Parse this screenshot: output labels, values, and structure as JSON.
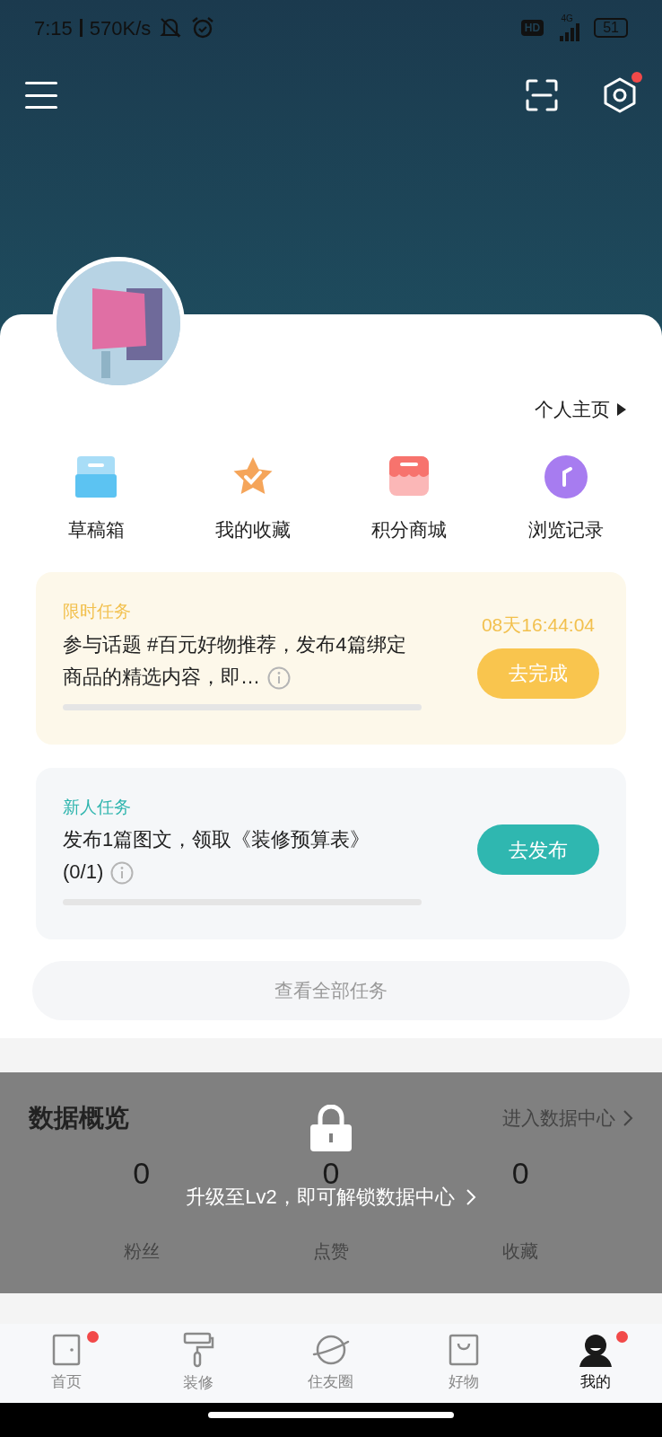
{
  "status_bar": {
    "time": "7:15",
    "speed": "570K/s",
    "hd": "HD",
    "network": "4G",
    "battery": "51"
  },
  "profile": {
    "homepage_link": "个人主页"
  },
  "shortcuts": [
    {
      "kind": "drafts",
      "label": "草稿箱"
    },
    {
      "kind": "favorites",
      "label": "我的收藏"
    },
    {
      "kind": "shop",
      "label": "积分商城"
    },
    {
      "kind": "history",
      "label": "浏览记录"
    }
  ],
  "tasks": [
    {
      "kind": "limited",
      "tag": "限时任务",
      "text": "参与话题 #百元好物推荐，发布4篇绑定商品的精选内容，即…",
      "countdown": "08天16:44:04",
      "button": "去完成",
      "level": 0
    },
    {
      "kind": "newbie",
      "tag": "新人任务",
      "text": "发布1篇图文，领取《装修预算表》(0/1)",
      "button": "去发布",
      "level": 0
    }
  ],
  "all_tasks_button": "查看全部任务",
  "data_overview": {
    "title": "数据概览",
    "link": "进入数据中心",
    "locked": true,
    "lock_message": "升级至Lv2，即可解锁数据中心",
    "stats": [
      {
        "value": "0",
        "label": "粉丝"
      },
      {
        "value": "0",
        "label": "点赞"
      },
      {
        "value": "0",
        "label": "收藏"
      }
    ]
  },
  "tab_bar": [
    {
      "kind": "home",
      "label": "首页",
      "selected": false,
      "badge": true
    },
    {
      "kind": "renovate",
      "label": "装修",
      "selected": false,
      "badge": false
    },
    {
      "kind": "circle",
      "label": "住友圈",
      "selected": false,
      "badge": false
    },
    {
      "kind": "goods",
      "label": "好物",
      "selected": false,
      "badge": false
    },
    {
      "kind": "me",
      "label": "我的",
      "selected": true,
      "badge": true
    }
  ]
}
